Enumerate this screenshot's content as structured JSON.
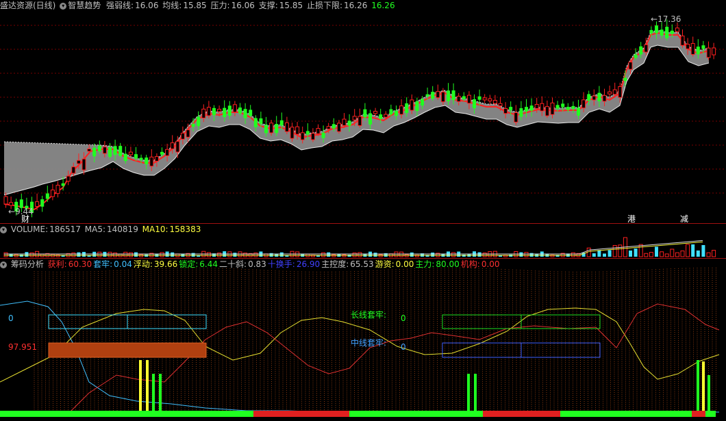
{
  "main": {
    "title": "盛达资源(日线)",
    "indicator": "智慧趋势",
    "items": [
      {
        "label": "强弱线:",
        "value": "16.06"
      },
      {
        "label": "均线:",
        "value": "15.85"
      },
      {
        "label": "压力:",
        "value": "16.06"
      },
      {
        "label": "支撑:",
        "value": "15.85"
      },
      {
        "label": "止损下限:",
        "value": "16.26"
      }
    ],
    "extra_value": "16.26",
    "high_label": "17.36",
    "low_label": "9.44",
    "tag_cai": "财",
    "tag_gang": "港",
    "tag_jian": "减"
  },
  "volume": {
    "label": "VOLUME:",
    "value": "186517",
    "ma5_label": "MA5:",
    "ma5": "140819",
    "ma10_label": "MA10:",
    "ma10": "158383"
  },
  "chip": {
    "title": "筹码分析",
    "items": [
      {
        "label": "获利:",
        "value": "60.30",
        "color": "#ff3030"
      },
      {
        "label": "套牢:",
        "value": "0.04",
        "color": "#40c0ff"
      },
      {
        "label": "浮动:",
        "value": "39.66",
        "color": "#ffff40"
      },
      {
        "label": "锁定:",
        "value": "6.44",
        "color": "#20ff20"
      },
      {
        "label": "二十斜:",
        "value": "0.83",
        "color": "#c0c0c0"
      },
      {
        "label": "十换手:",
        "value": "26.90",
        "color": "#4040ff"
      },
      {
        "label": "主控度:",
        "value": "65.53",
        "color": "#c0c0c0"
      },
      {
        "label": "游资:",
        "value": "0.00",
        "color": "#ffff40"
      },
      {
        "label": "主力:",
        "value": "80.00",
        "color": "#20ff20"
      },
      {
        "label": "机构:",
        "value": "0.00",
        "color": "#ff3030"
      }
    ],
    "left_top_value": "0",
    "left_bottom_value": "97.951",
    "long_label": "长线套牢:",
    "long_value": "0",
    "mid_label": "中线套牢:",
    "mid_value": "0"
  },
  "colors": {
    "up": "#ff2020",
    "down": "#20ff20",
    "grid": "#a01010",
    "bg": "#000000"
  }
}
